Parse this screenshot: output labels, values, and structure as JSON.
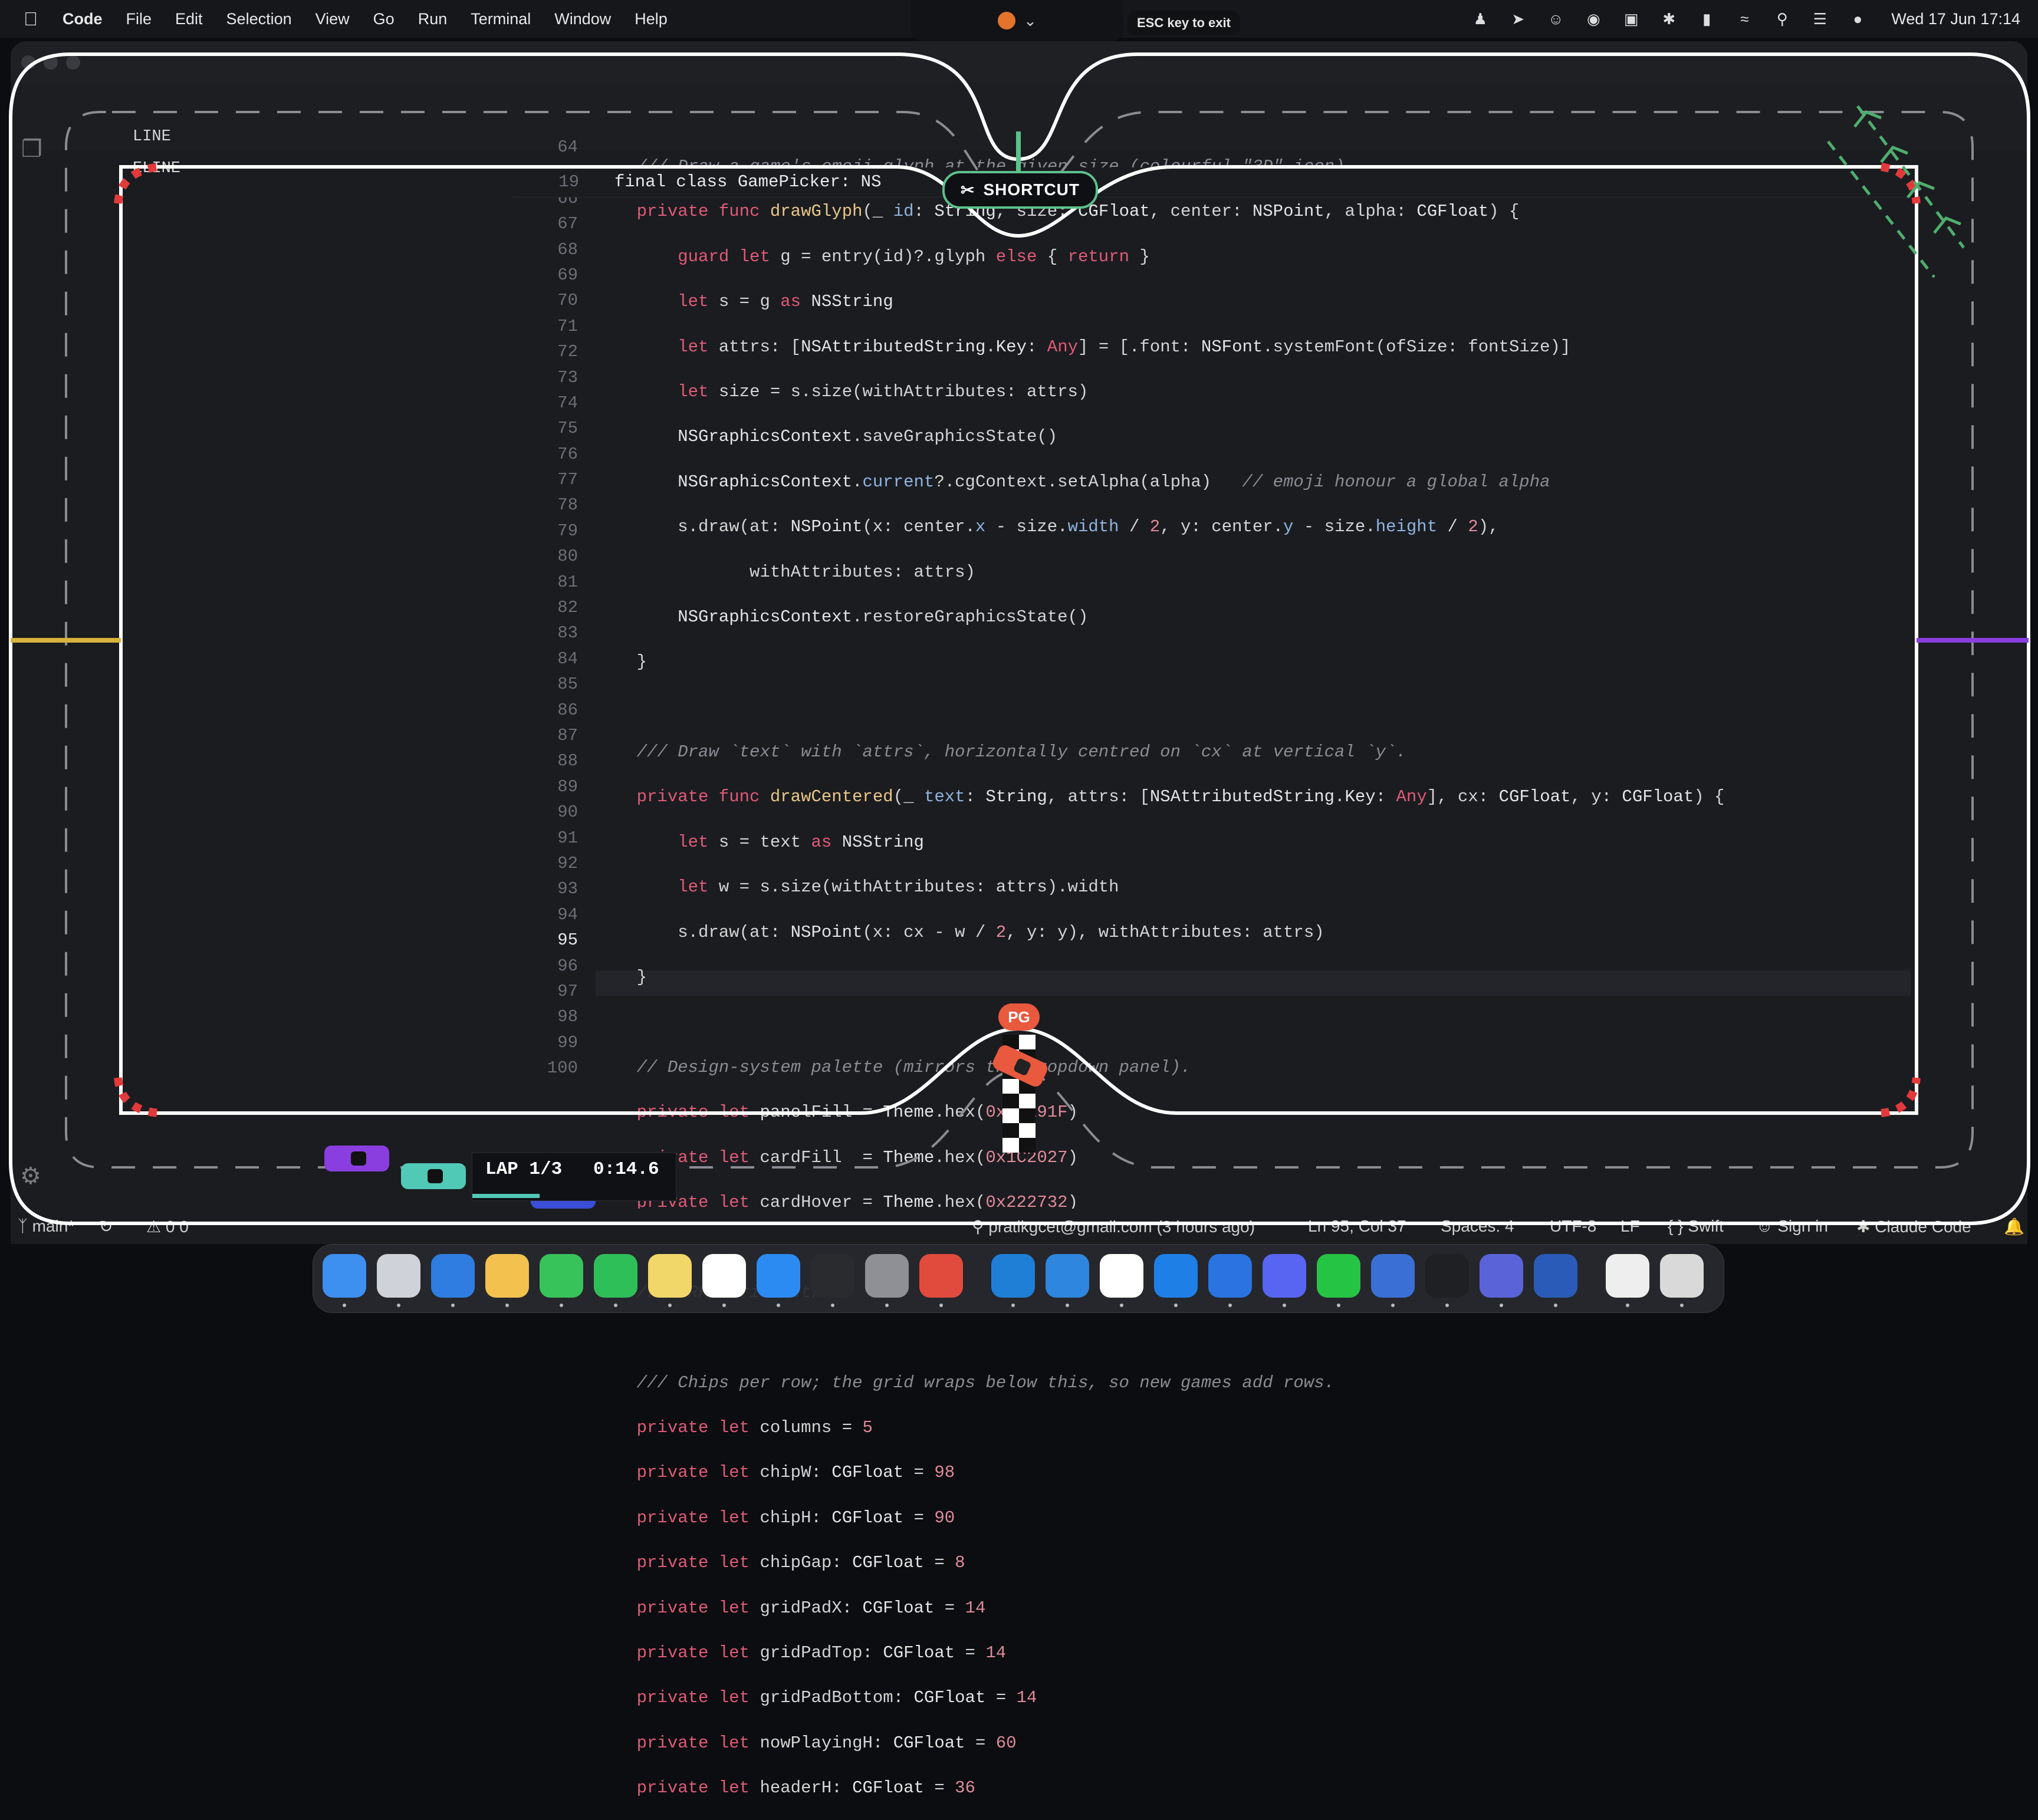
{
  "menubar": {
    "app_name": "Code",
    "menus": [
      "File",
      "Edit",
      "Selection",
      "View",
      "Go",
      "Run",
      "Terminal",
      "Window",
      "Help"
    ],
    "clock": "Wed 17 Jun  17:14"
  },
  "overlay": {
    "esc_hint": "ESC key to exit",
    "shortcut_label": "SHORTCUT",
    "lap_label": "LAP 1/3",
    "lap_time": "0:14.6",
    "lap_progress": 0.33,
    "badge": "PG"
  },
  "outline": [
    "LINE",
    "ELINE"
  ],
  "editor": {
    "sticky_line": {
      "number": "19",
      "text": "final class GamePicker: NS"
    },
    "current_line": "95",
    "line_numbers": [
      "64",
      "65",
      "66",
      "67",
      "68",
      "69",
      "70",
      "71",
      "72",
      "73",
      "74",
      "75",
      "76",
      "77",
      "78",
      "79",
      "80",
      "81",
      "82",
      "83",
      "84",
      "85",
      "86",
      "87",
      "88",
      "89",
      "90",
      "91",
      "92",
      "93",
      "94",
      "95",
      "96",
      "97",
      "98",
      "99",
      "100"
    ]
  },
  "status": {
    "branch": "main*",
    "problems": "0 0",
    "author": "pratikgcet@gmail.com (3 hours ago)",
    "cursor": "Ln 95, Col 37",
    "spaces": "Spaces: 4",
    "encoding": "UTF-8",
    "eol": "LF",
    "language": "Swift",
    "sign_in": "Sign in",
    "assistant": "Claude Code"
  },
  "colors": {
    "track_line": "#ffffff",
    "start_line": "#5cc18b",
    "kerb_red": "#e23a3a",
    "left_checkpoint": "#d6b33a",
    "right_checkpoint": "#8a3ee0",
    "lap_bar": "#51c9b7"
  },
  "dock": [
    "finder-icon",
    "launchpad-icon",
    "safari-icon",
    "photos-icon",
    "messages-icon",
    "facetime-icon",
    "notes-icon",
    "chrome-icon",
    "app-store-icon",
    "terminal-icon",
    "settings-icon",
    "music-icon",
    "vscode-icon",
    "docker-icon",
    "slack-icon",
    "quicktime-icon",
    "mail-icon",
    "discord-icon",
    "whatsapp-icon",
    "xcode-icon",
    "activity-monitor-icon",
    "teams-icon",
    "word-icon",
    "document-icon",
    "trash-icon"
  ]
}
